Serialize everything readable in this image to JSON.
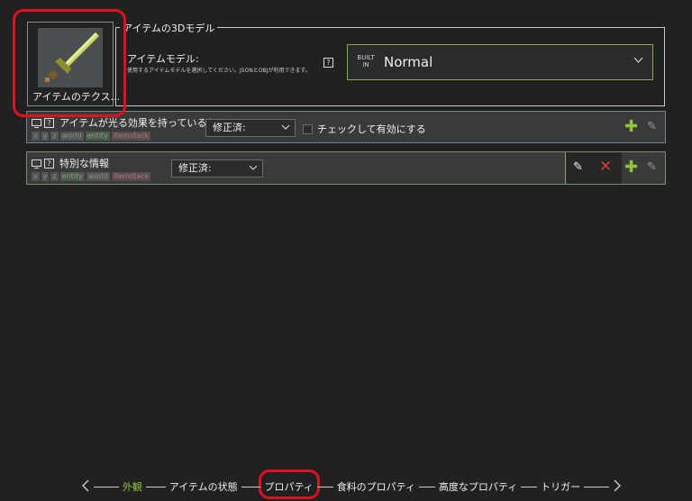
{
  "texture": {
    "label": "アイテムのテクス..."
  },
  "model": {
    "legend": "アイテムの3Dモデル",
    "label": "アイテムモデル:",
    "hint": "使用するアイテムモデルを選択してください。JSONとOBJが利用できます。",
    "help": "?",
    "built_badge": "BUILT IN",
    "value": "Normal"
  },
  "procedures": [
    {
      "help": "?",
      "title": "アイテムが光る効果を持っているか",
      "deps": [
        "x",
        "y",
        "z",
        "world",
        "entity",
        "itemstack"
      ],
      "dropdown": "修正済:",
      "checkbox_label": "チェックして有効にする"
    },
    {
      "help": "?",
      "title": "特別な情報",
      "deps": [
        "x",
        "y",
        "z",
        "entity",
        "world",
        "itemstack"
      ],
      "dropdown": "修正済:"
    }
  ],
  "nav": {
    "steps": [
      "外観",
      "アイテムの状態",
      "プロパティ",
      "食料のプロパティ",
      "高度なプロパティ",
      "トリガー"
    ],
    "active_index": 0
  },
  "colors": {
    "accent": "#8fc43e",
    "delete": "#d63c3c",
    "highlight": "#e0101c"
  }
}
